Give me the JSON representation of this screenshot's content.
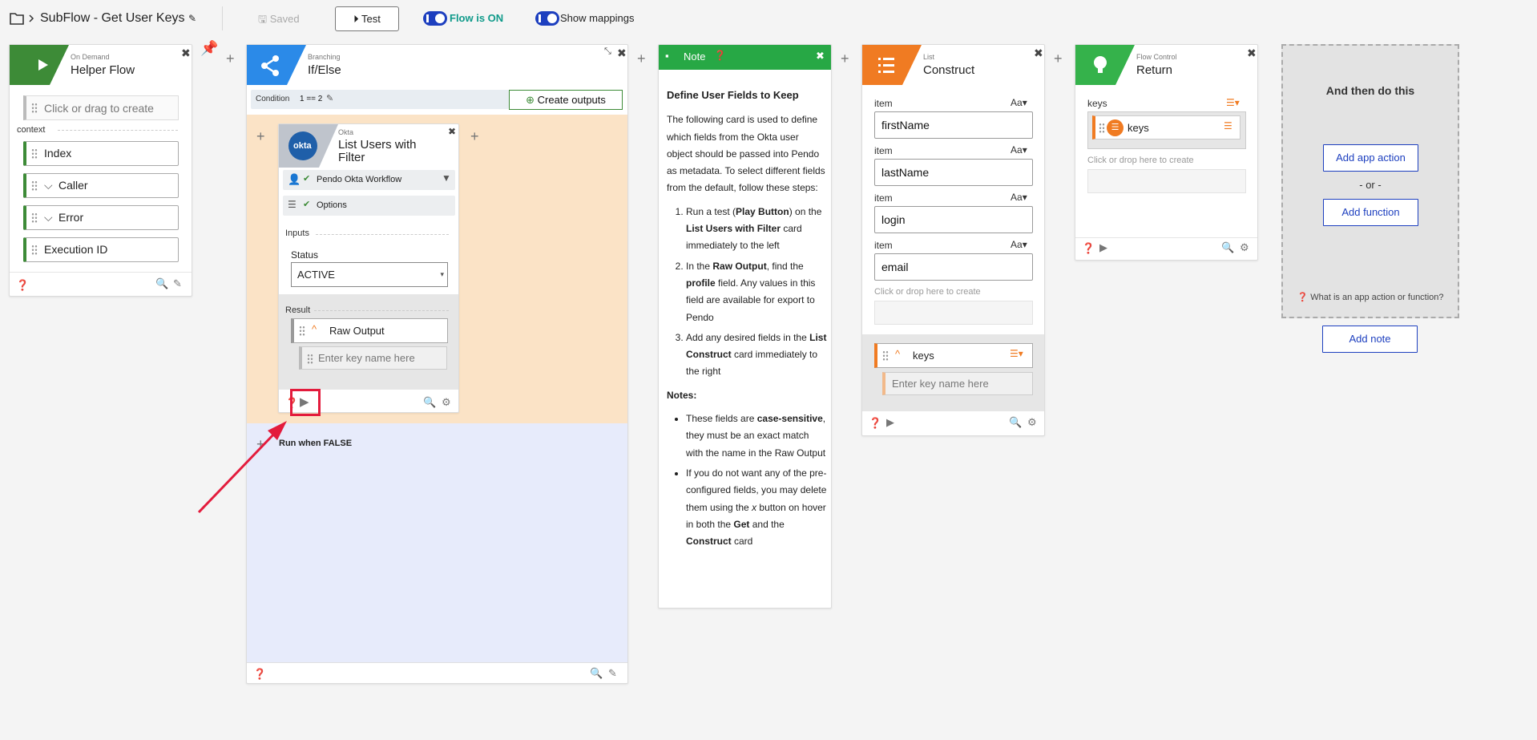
{
  "header": {
    "title": "SubFlow - Get User Keys",
    "saved_label": "Saved",
    "test_label": "Test",
    "flow_status": "Flow is ON",
    "show_mappings": "Show mappings"
  },
  "helper_card": {
    "subtitle": "On Demand",
    "title": "Helper Flow",
    "placeholder": "Click or drag to create",
    "context_label": "context",
    "fields": [
      "Index",
      "Caller",
      "Error",
      "Execution ID"
    ]
  },
  "branch_card": {
    "subtitle": "Branching",
    "title": "If/Else",
    "condition_label": "Condition",
    "condition_value": "1 == 2",
    "create_outputs": "Create outputs",
    "run_false": "Run when FALSE"
  },
  "okta_card": {
    "subtitle": "Okta",
    "title": "List Users with Filter",
    "logo_text": "okta",
    "connection": "Pendo Okta Workflow",
    "options": "Options",
    "inputs_label": "Inputs",
    "status_label": "Status",
    "status_value": "ACTIVE",
    "result_label": "Result",
    "raw_output": "Raw Output",
    "key_placeholder": "Enter key name here"
  },
  "note_card": {
    "title": "Note",
    "heading": "Define User Fields to Keep",
    "intro": "The following card is used to define which fields from the Okta user object should be passed into Pendo as metadata. To select different fields from the default, follow these steps:",
    "step1_a": "Run a test (",
    "step1_b": "Play Button",
    "step1_c": ") on the ",
    "step1_d": "List Users with Filter",
    "step1_e": " card immediately to the left",
    "step2_a": "In the ",
    "step2_b": "Raw Output",
    "step2_c": ", find the ",
    "step2_d": "profile",
    "step2_e": " field. Any values in this field are available for export to Pendo",
    "step3_a": "Add any desired fields in the ",
    "step3_b": "List Construct",
    "step3_c": " card immediately to the right",
    "notes_label": "Notes:",
    "bullet1_a": "These fields are ",
    "bullet1_b": "case-sensitive",
    "bullet1_c": ", they must be an exact match with the name in the Raw Output",
    "bullet2_a": "If you do not want any of the pre-configured fields, you may delete them using the ",
    "bullet2_b": "x",
    "bullet2_c": " button on hover in both the ",
    "bullet2_d": "Get",
    "bullet2_e": " and the ",
    "bullet2_f": "Construct",
    "bullet2_g": " card"
  },
  "list_card": {
    "subtitle": "List",
    "title": "Construct",
    "item_label": "item",
    "aa": "Aa",
    "items": [
      "firstName",
      "lastName",
      "login",
      "email"
    ],
    "drop_hint": "Click or drop here to create",
    "output_key": "keys",
    "key_placeholder": "Enter key name here"
  },
  "return_card": {
    "subtitle": "Flow Control",
    "title": "Return",
    "keys_label": "keys",
    "key_pill": "keys",
    "drop_hint": "Click or drop here to create"
  },
  "next_panel": {
    "heading": "And then do this",
    "add_app_action": "Add app action",
    "or": "- or -",
    "add_function": "Add function",
    "help": "What is an app action or function?",
    "add_note": "Add note"
  },
  "colors": {
    "green": "#3d8b37",
    "blue_branch": "#2b8ae8",
    "note_green": "#27a845",
    "orange": "#f07b22",
    "return_green": "#35b24b",
    "highlight_red": "#e31b3c",
    "true_bg": "#fbe3c6",
    "false_bg": "#e7ebfb"
  }
}
